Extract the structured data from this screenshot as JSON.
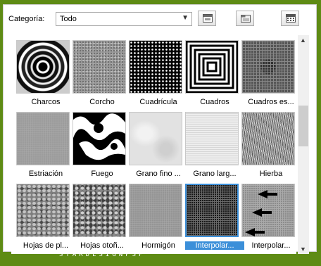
{
  "header": {
    "category_label": "Categoría:",
    "category_value": "Todo"
  },
  "toolbar": {
    "buttons": [
      "window-icon",
      "folder-icon",
      "calculator-icon"
    ]
  },
  "gallery": {
    "items": [
      {
        "label": "Charcos",
        "texture": "ripples",
        "selected": false
      },
      {
        "label": "Corcho",
        "texture": "cork",
        "selected": false
      },
      {
        "label": "Cuadrícula",
        "texture": "grid",
        "selected": false
      },
      {
        "label": "Cuadros",
        "texture": "squares",
        "selected": false
      },
      {
        "label": "Cuadros es...",
        "texture": "squares-pattern",
        "selected": false
      },
      {
        "label": "Estriación",
        "texture": "striation",
        "selected": false
      },
      {
        "label": "Fuego",
        "texture": "fire",
        "selected": false
      },
      {
        "label": "Grano fino ...",
        "texture": "fine-grain",
        "selected": false
      },
      {
        "label": "Grano larg...",
        "texture": "long-grain",
        "selected": false
      },
      {
        "label": "Hierba",
        "texture": "grass",
        "selected": false
      },
      {
        "label": "Hojas de pl...",
        "texture": "leaves",
        "selected": false
      },
      {
        "label": "Hojas otoñ...",
        "texture": "autumn-leaves",
        "selected": false
      },
      {
        "label": "Hormigón",
        "texture": "concrete",
        "selected": false
      },
      {
        "label": "Interpolar...",
        "texture": "interpolate-grid",
        "selected": true
      },
      {
        "label": "Interpolar...",
        "texture": "interpolate-arrows",
        "selected": false
      }
    ]
  },
  "watermark": "STARDESIGNPSP",
  "colors": {
    "frame": "#5e8b14",
    "selection": "#3b8fd9"
  }
}
